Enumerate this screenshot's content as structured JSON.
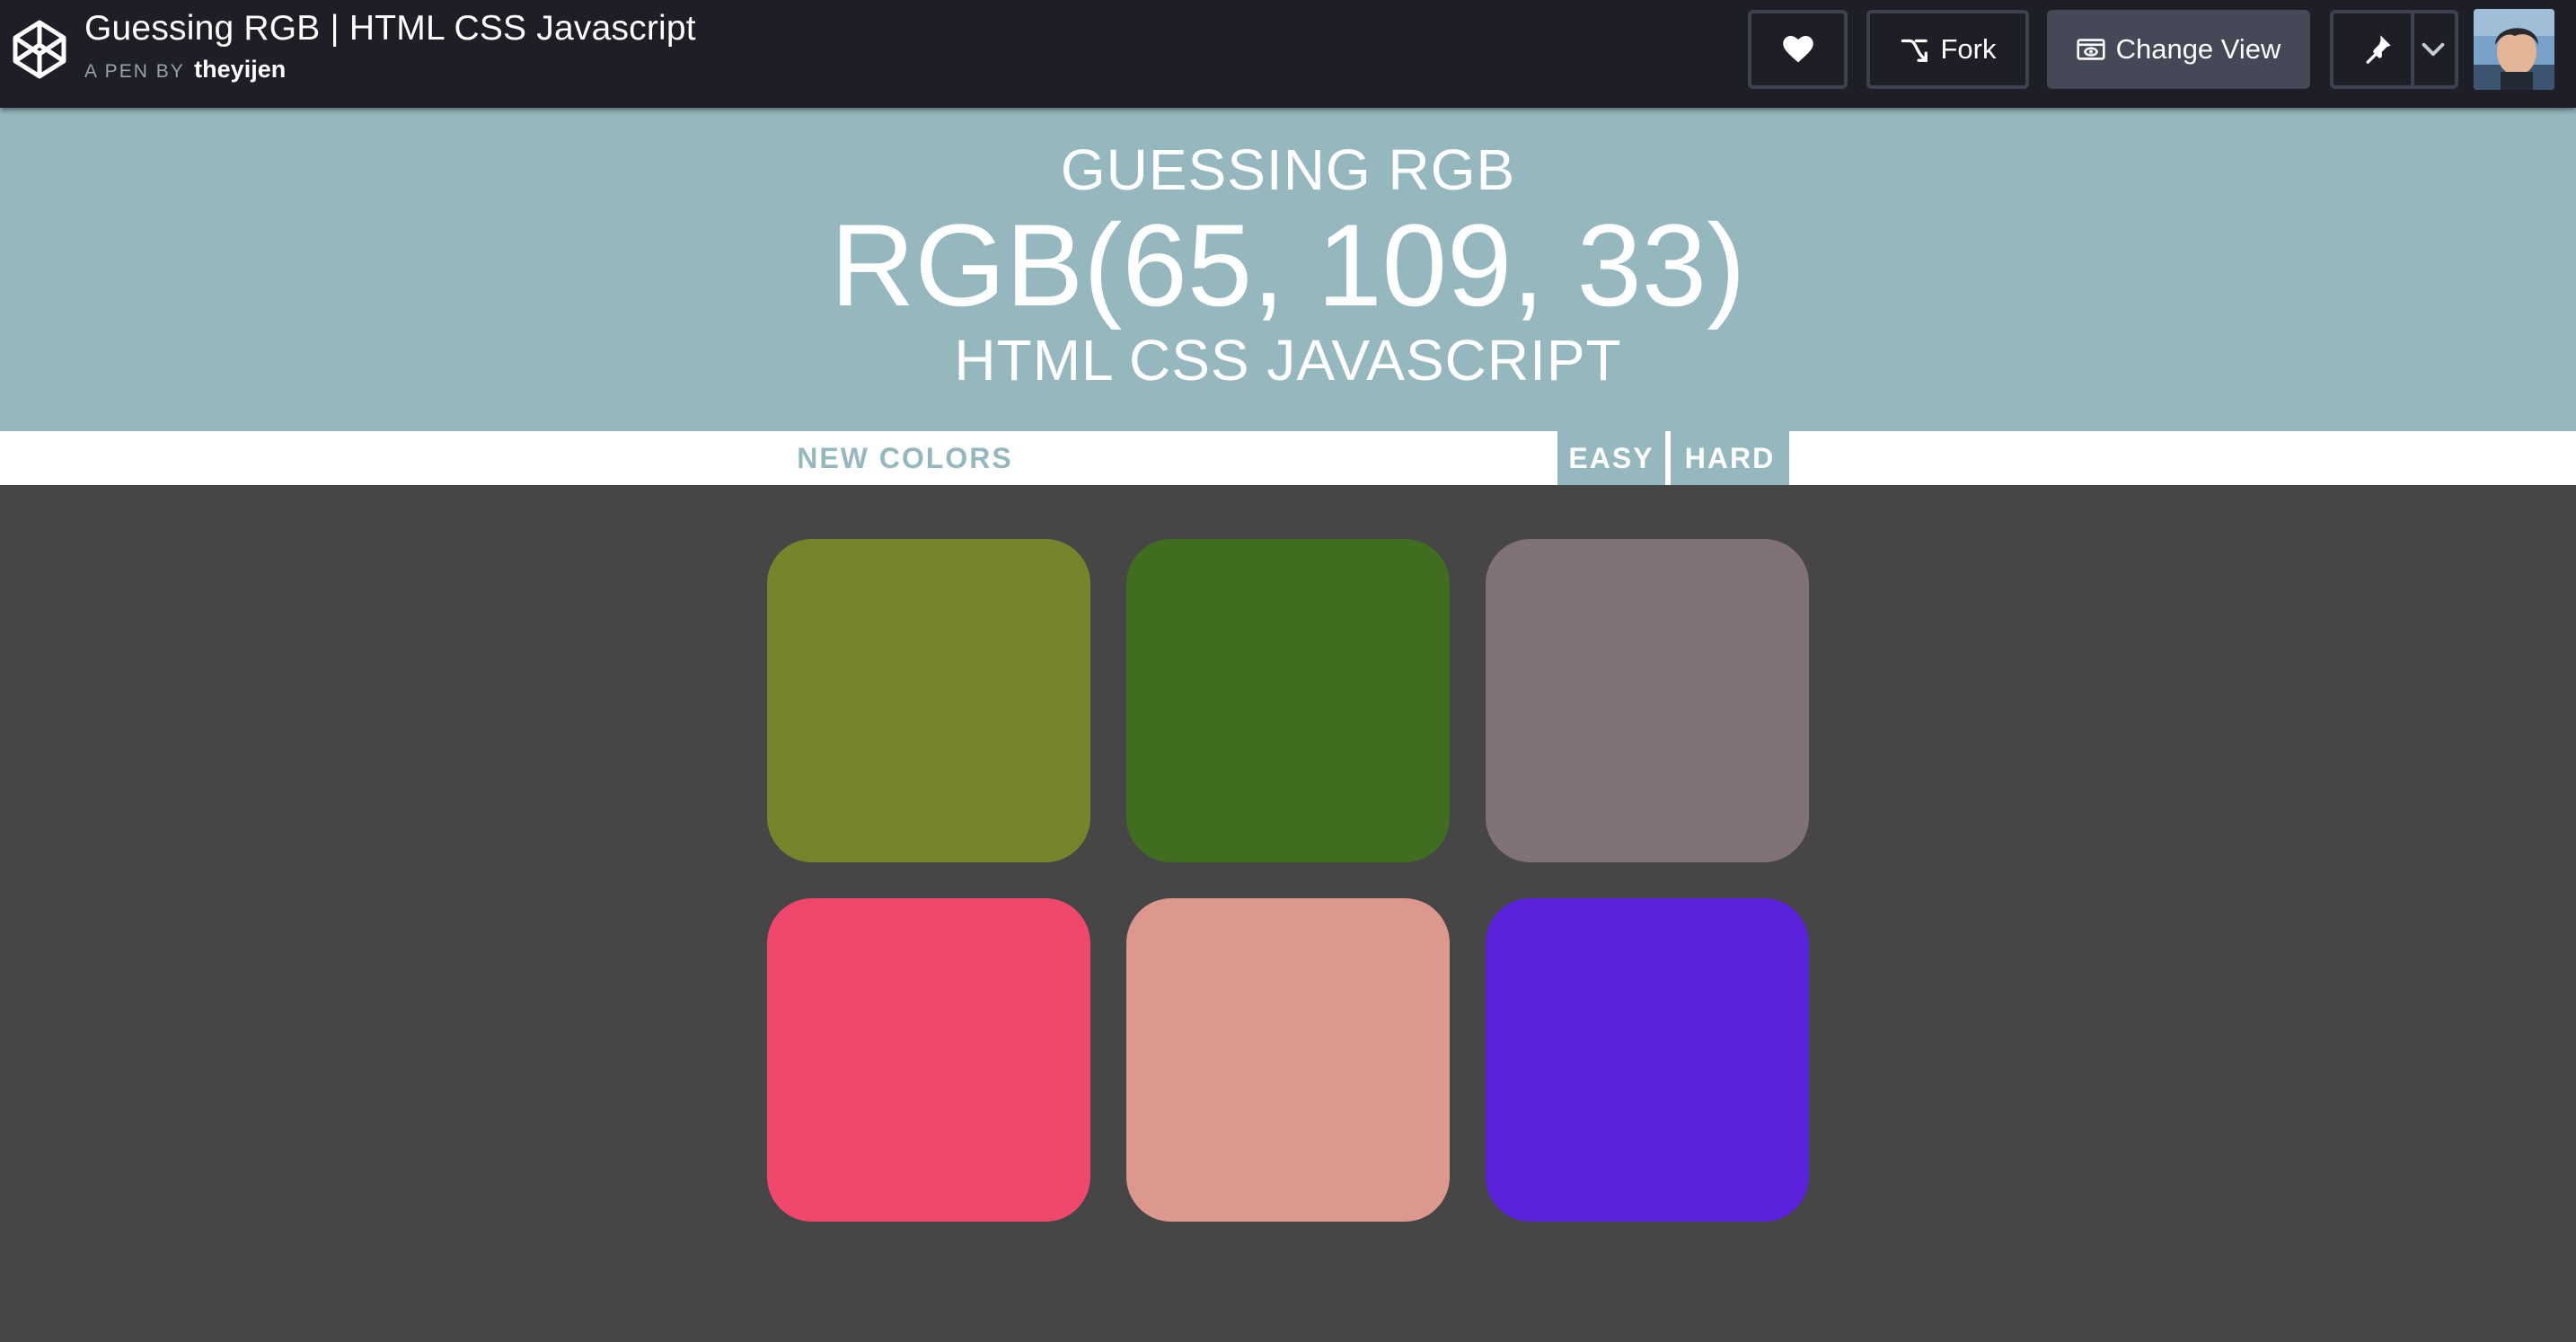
{
  "codepen": {
    "title": "Guessing RGB | HTML CSS Javascript",
    "byline_prefix": "A PEN BY",
    "author": "theyijen",
    "buttons": {
      "heart_icon": "heart-icon",
      "fork_label": "Fork",
      "change_view_label": "Change View",
      "pin_icon": "pin-icon"
    }
  },
  "game": {
    "header": {
      "line1": "GUESSING RGB",
      "rgb_display": "RGB(65, 109, 33)",
      "line3": "HTML CSS JAVASCRIPT"
    },
    "stripe": {
      "new_colors_label": "NEW COLORS",
      "easy_label": "EASY",
      "hard_label": "HARD",
      "selected_mode": "EASY"
    },
    "colors": {
      "header_bg": "#95b8be",
      "body_bg": "#464646",
      "topbar_bg": "#1e1f26"
    },
    "squares": [
      {
        "color": "#77842c"
      },
      {
        "color": "#416d21"
      },
      {
        "color": "#817277"
      },
      {
        "color": "#f0486d"
      },
      {
        "color": "#dc988c"
      },
      {
        "color": "#5a22da"
      }
    ]
  }
}
